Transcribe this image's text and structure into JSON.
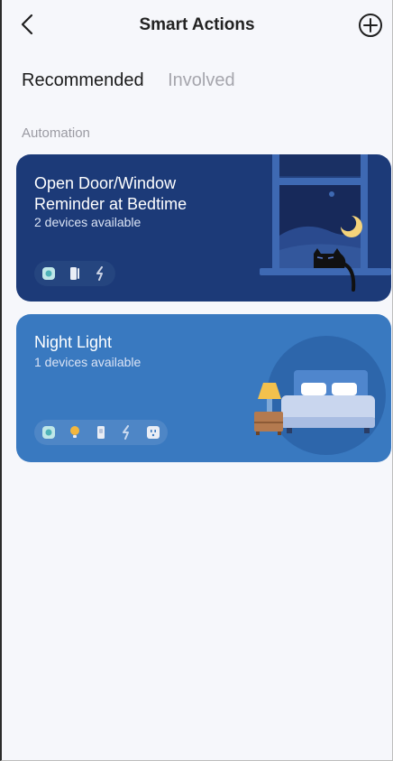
{
  "header": {
    "title": "Smart Actions",
    "back_icon": "chevron-left-icon",
    "add_icon": "plus-circle-icon"
  },
  "tabs": [
    {
      "label": "Recommended",
      "active": true
    },
    {
      "label": "Involved",
      "active": false
    }
  ],
  "section": {
    "label": "Automation"
  },
  "cards": [
    {
      "title": "Open Door/Window Reminder at Bedtime",
      "subtitle": "2 devices available",
      "background": "#1c3a78",
      "device_icons": [
        "hub-icon",
        "contact-sensor-icon",
        "link-icon"
      ]
    },
    {
      "title": "Night Light",
      "subtitle": "1 devices available",
      "background": "#3979c0",
      "device_icons": [
        "hub-icon",
        "bulb-icon",
        "switch-icon",
        "link-icon",
        "smart-plug-icon"
      ]
    }
  ],
  "colors": {
    "background": "#f6f7fb",
    "title_text": "#222222",
    "inactive_tab": "#a6a6ad",
    "card1_bg": "#1c3a78",
    "card2_bg": "#3979c0"
  }
}
